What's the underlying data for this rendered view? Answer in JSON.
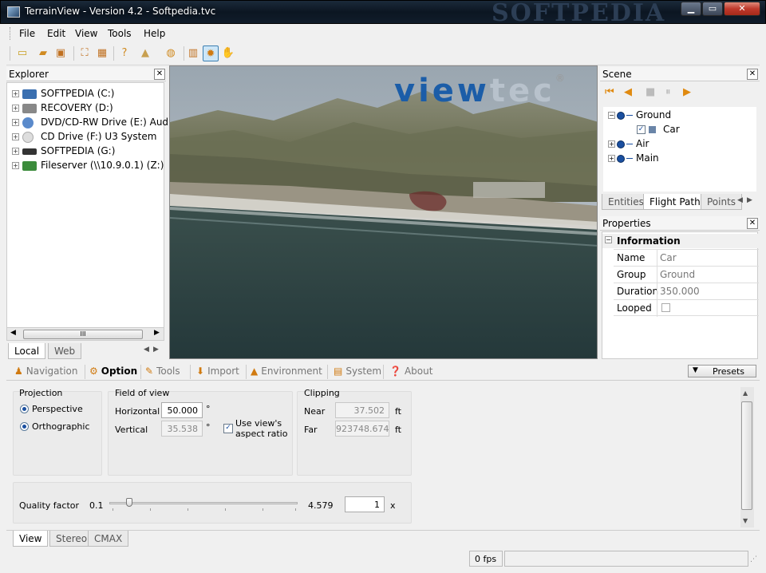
{
  "window": {
    "title": "TerrainView - Version 4.2 - Softpedia.tvc",
    "watermark": "SOFTPEDIA",
    "minimize": "▁",
    "maximize": "▭",
    "close": "✕"
  },
  "menu": [
    "File",
    "Edit",
    "View",
    "Tools",
    "Help"
  ],
  "toolbar": {
    "icons": [
      "new-file-icon",
      "open-folder-icon",
      "save-icon",
      "fit-view-icon",
      "grid-icon",
      "help-icon",
      "terrain-icon",
      "globe-icon",
      "ruler-icon",
      "sun-icon",
      "hand-icon"
    ]
  },
  "explorer": {
    "title": "Explorer",
    "close": "✕",
    "drives": [
      {
        "label": "SOFTPEDIA (C:)",
        "color": "#3a6fb0"
      },
      {
        "label": "RECOVERY (D:)",
        "color": "#888888"
      },
      {
        "label": "DVD/CD-RW Drive (E:) Audio",
        "color": "#5a8acb"
      },
      {
        "label": "CD Drive (F:) U3 System",
        "color": "#bbbbbb"
      },
      {
        "label": "SOFTPEDIA (G:)",
        "color": "#333333"
      },
      {
        "label": "Fileserver (\\\\10.9.0.1) (Z:)",
        "color": "#3c8c3c"
      }
    ],
    "tabs": [
      "Local",
      "Web"
    ],
    "scroll_grip": "III"
  },
  "viewport": {
    "logo_part1": "view",
    "logo_part2": "tec",
    "logo_reg": "®"
  },
  "scene": {
    "title": "Scene",
    "close": "✕",
    "nodes": [
      {
        "label": "Ground",
        "expand": "−"
      },
      {
        "label": "Car",
        "expand": ""
      },
      {
        "label": "Air",
        "expand": "+"
      },
      {
        "label": "Main",
        "expand": "+"
      }
    ],
    "tabs": [
      "Entities",
      "Flight Paths",
      "Points"
    ]
  },
  "properties": {
    "title": "Properties",
    "close": "✕",
    "section": "Information",
    "rows": [
      {
        "key": "Name",
        "value": "Car"
      },
      {
        "key": "Group",
        "value": "Ground"
      },
      {
        "key": "Duration",
        "value": "350.000"
      },
      {
        "key": "Looped",
        "value": ""
      }
    ]
  },
  "options": {
    "tabs": [
      {
        "label": "Navigation",
        "icon": "navigation-icon"
      },
      {
        "label": "Option",
        "icon": "gear-icon"
      },
      {
        "label": "Tools",
        "icon": "wrench-icon"
      },
      {
        "label": "Import",
        "icon": "import-icon"
      },
      {
        "label": "Environment",
        "icon": "environment-icon"
      },
      {
        "label": "System",
        "icon": "system-icon"
      },
      {
        "label": "About",
        "icon": "help-icon"
      }
    ],
    "presets": "Presets",
    "projection": {
      "title": "Projection",
      "perspective": "Perspective",
      "orthographic": "Orthographic"
    },
    "fov": {
      "title": "Field of view",
      "horizontal_label": "Horizontal",
      "horizontal": "50.000",
      "vertical_label": "Vertical",
      "vertical": "35.538",
      "unit": "°",
      "aspect_line1": "Use view's",
      "aspect_line2": "aspect ratio"
    },
    "clipping": {
      "title": "Clipping",
      "near_label": "Near",
      "near": "37.502",
      "far_label": "Far",
      "far": "923748.674",
      "unit": "ft"
    },
    "quality": {
      "label": "Quality factor",
      "min": "0.1",
      "max": "4.579",
      "value": "1",
      "suffix": "x"
    }
  },
  "bottom_tabs": [
    "View",
    "Stereo",
    "CMAX"
  ],
  "status": {
    "fps": "0 fps"
  }
}
